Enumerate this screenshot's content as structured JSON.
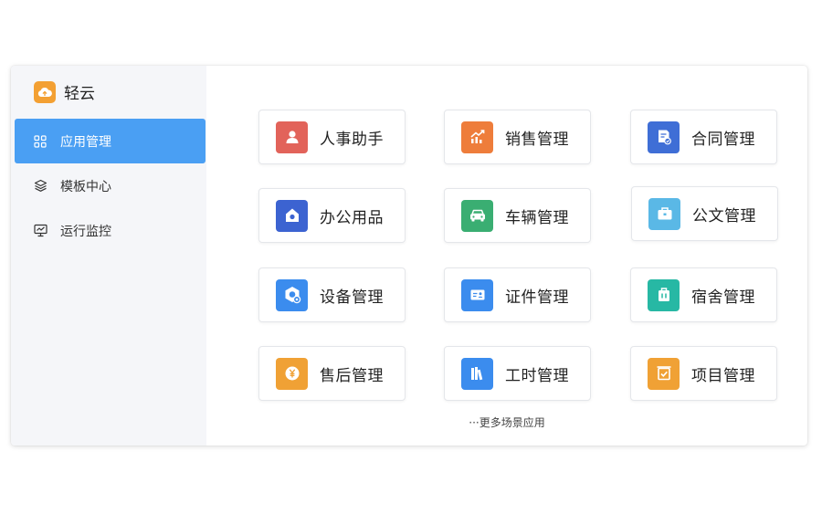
{
  "brand": {
    "name": "轻云",
    "logo_icon": "cloud-icon",
    "logo_color": "#f3a033"
  },
  "sidebar": {
    "active_color": "#4a9ff3",
    "items": [
      {
        "label": "应用管理",
        "icon": "grid-icon",
        "active": true
      },
      {
        "label": "模板中心",
        "icon": "layers-icon",
        "active": false
      },
      {
        "label": "运行监控",
        "icon": "monitor-icon",
        "active": false
      }
    ]
  },
  "apps": [
    {
      "label": "人事助手",
      "icon": "person-icon",
      "color": "#e2635a"
    },
    {
      "label": "销售管理",
      "icon": "trend-chart-icon",
      "color": "#ee7d3b"
    },
    {
      "label": "合同管理",
      "icon": "contract-icon",
      "color": "#3f6ed6"
    },
    {
      "label": "办公用品",
      "icon": "house-icon",
      "color": "#3c63d1"
    },
    {
      "label": "车辆管理",
      "icon": "car-icon",
      "color": "#3aae72"
    },
    {
      "label": "公文管理",
      "icon": "briefcase-icon",
      "color": "#5ab8e6"
    },
    {
      "label": "设备管理",
      "icon": "device-icon",
      "color": "#3b8cee"
    },
    {
      "label": "证件管理",
      "icon": "id-card-icon",
      "color": "#3b8cee"
    },
    {
      "label": "宿舍管理",
      "icon": "dormitory-icon",
      "color": "#27b8a4"
    },
    {
      "label": "售后管理",
      "icon": "yen-coin-icon",
      "color": "#f0a135"
    },
    {
      "label": "工时管理",
      "icon": "books-icon",
      "color": "#3b8cee"
    },
    {
      "label": "项目管理",
      "icon": "project-check-icon",
      "color": "#f0a135"
    }
  ],
  "more_link": "···更多场景应用"
}
